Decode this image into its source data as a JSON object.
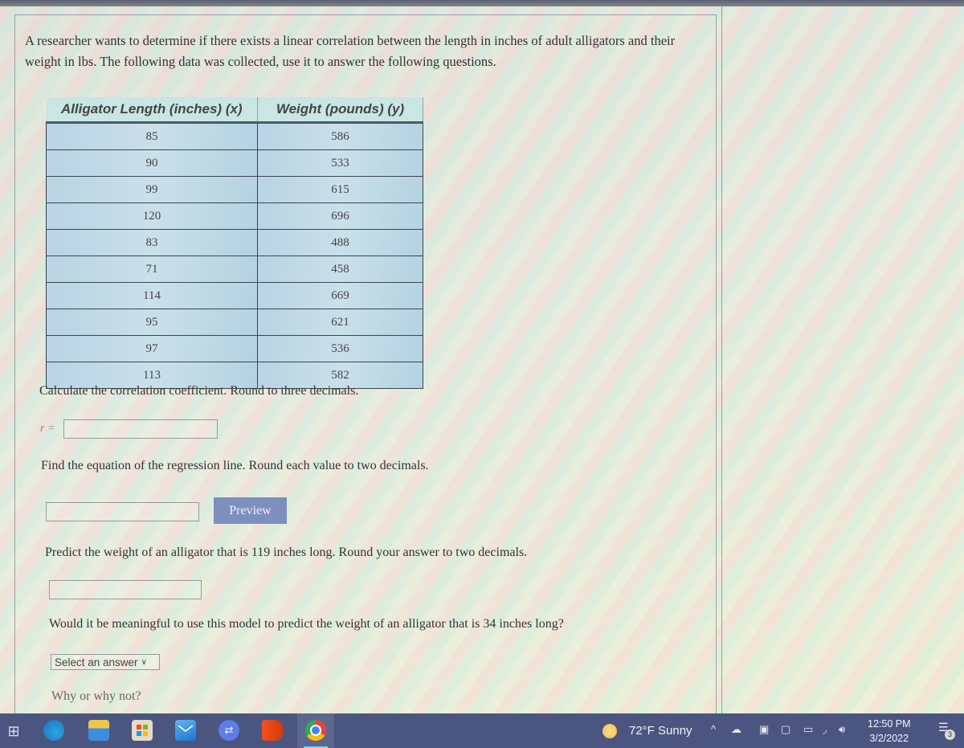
{
  "intro_text": "A researcher wants to determine if there exists a linear correlation between the length in inches of adult alligators and their weight in lbs. The following data was collected, use it to answer the following questions.",
  "table": {
    "headers": [
      "Alligator Length (inches) (x)",
      "Weight (pounds) (y)"
    ],
    "rows": [
      [
        "85",
        "586"
      ],
      [
        "90",
        "533"
      ],
      [
        "99",
        "615"
      ],
      [
        "120",
        "696"
      ],
      [
        "83",
        "488"
      ],
      [
        "71",
        "458"
      ],
      [
        "114",
        "669"
      ],
      [
        "95",
        "621"
      ],
      [
        "97",
        "536"
      ],
      [
        "113",
        "582"
      ]
    ]
  },
  "questions": {
    "q1": "Calculate the correlation coefficient. Round to three decimals.",
    "r_label": "r =",
    "r_value": "",
    "q2": "Find the equation of the regression line. Round each value to two decimals.",
    "regression_value": "",
    "preview_label": "Preview",
    "q3": "Predict the weight of an alligator that is 119 inches long. Round your answer to two decimals.",
    "prediction_value": "",
    "q4": "Would it be meaningful to use this model to predict the weight of an alligator that is 34 inches long?",
    "select_label": "Select an answer",
    "q5": "Why or why not?"
  },
  "taskbar": {
    "apps": [
      "task-view",
      "edge",
      "file-explorer",
      "microsoft-store",
      "mail",
      "remote-desktop",
      "office",
      "chrome"
    ],
    "weather": "72°F  Sunny",
    "tray_chevron": "^",
    "time": "12:50 PM",
    "date": "3/2/2022",
    "notification_count": "3"
  }
}
